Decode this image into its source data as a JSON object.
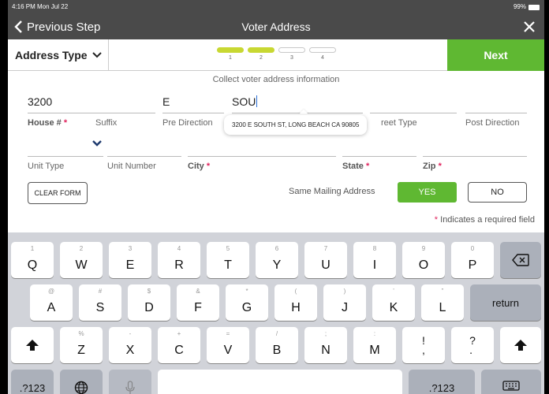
{
  "status": {
    "time": "4:16 PM  Mon Jul 22",
    "battery": "99%"
  },
  "nav": {
    "back_label": "Previous Step",
    "title": "Voter Address",
    "close_icon": "close-icon"
  },
  "steps": {
    "dropdown_label": "Address Type",
    "items": [
      {
        "num": "1",
        "active": true
      },
      {
        "num": "2",
        "active": true
      },
      {
        "num": "3",
        "active": false
      },
      {
        "num": "4",
        "active": false
      }
    ],
    "next_label": "Next"
  },
  "form": {
    "subtitle": "Collect voter address information",
    "house_number": {
      "value": "3200",
      "label": "House #",
      "req": "*"
    },
    "suffix": {
      "value": "",
      "label": "Suffix"
    },
    "pre_direction": {
      "value": "E",
      "label": "Pre Direction"
    },
    "street_name": {
      "value": "SOU"
    },
    "street_type": {
      "value": "",
      "label": "reet Type"
    },
    "post_direction": {
      "value": "",
      "label": "Post Direction"
    },
    "unit_type": {
      "value": "",
      "label": "Unit Type"
    },
    "unit_number": {
      "value": "",
      "label": "Unit Number"
    },
    "city": {
      "value": "",
      "label": "City",
      "req": "*"
    },
    "state": {
      "value": "",
      "label": "State",
      "req": "*"
    },
    "zip": {
      "value": "",
      "label": "Zip",
      "req": "*"
    },
    "suggestion": "3200 E SOUTH ST, LONG BEACH CA 90805",
    "clear_label": "CLEAR FORM",
    "same_mailing_label": "Same Mailing Address",
    "yes_label": "YES",
    "no_label": "NO",
    "req_note_star": "*",
    "req_note_text": " Indicates a required field"
  },
  "keyboard": {
    "row1": [
      {
        "hint": "1",
        "key": "Q"
      },
      {
        "hint": "2",
        "key": "W"
      },
      {
        "hint": "3",
        "key": "E"
      },
      {
        "hint": "4",
        "key": "R"
      },
      {
        "hint": "5",
        "key": "T"
      },
      {
        "hint": "6",
        "key": "Y"
      },
      {
        "hint": "7",
        "key": "U"
      },
      {
        "hint": "8",
        "key": "I"
      },
      {
        "hint": "9",
        "key": "O"
      },
      {
        "hint": "0",
        "key": "P"
      }
    ],
    "row2": [
      {
        "hint": "@",
        "key": "A"
      },
      {
        "hint": "#",
        "key": "S"
      },
      {
        "hint": "$",
        "key": "D"
      },
      {
        "hint": "&",
        "key": "F"
      },
      {
        "hint": "*",
        "key": "G"
      },
      {
        "hint": "(",
        "key": "H"
      },
      {
        "hint": ")",
        "key": "J"
      },
      {
        "hint": "’",
        "key": "K"
      },
      {
        "hint": "”",
        "key": "L"
      }
    ],
    "row3": [
      {
        "hint": "%",
        "key": "Z"
      },
      {
        "hint": "-",
        "key": "X"
      },
      {
        "hint": "+",
        "key": "C"
      },
      {
        "hint": "=",
        "key": "V"
      },
      {
        "hint": "/",
        "key": "B"
      },
      {
        "hint": ";",
        "key": "N"
      },
      {
        "hint": ":",
        "key": "M"
      },
      {
        "hint": "",
        "key": "!\n,"
      },
      {
        "hint": "",
        "key": "?\n."
      }
    ],
    "return_label": "return",
    "numbers_label": ".?123",
    "delete_icon": "backspace-icon",
    "shift_icon": "shift-icon",
    "globe_icon": "globe-icon",
    "mic_icon": "microphone-icon",
    "hide_icon": "keyboard-hide-icon"
  }
}
